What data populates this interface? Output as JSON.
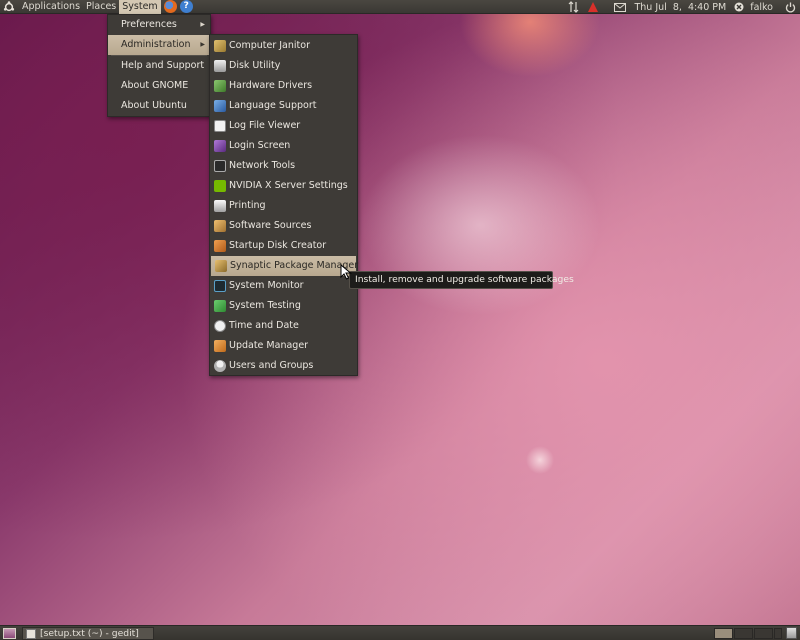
{
  "top_panel": {
    "menus": [
      "Applications",
      "Places",
      "System"
    ],
    "clock": "Thu Jul  8,  4:40 PM",
    "user": "falko"
  },
  "system_menu": {
    "items": [
      "Preferences",
      "Administration",
      "Help and Support",
      "About GNOME",
      "About Ubuntu"
    ],
    "selected": "Administration"
  },
  "admin_menu": {
    "items": [
      {
        "label": "Computer Janitor",
        "icon": "broom-icon",
        "color": "#c9a24a"
      },
      {
        "label": "Disk Utility",
        "icon": "disk-icon",
        "color": "#c8c8c8"
      },
      {
        "label": "Hardware Drivers",
        "icon": "chip-icon",
        "color": "#6aa04a"
      },
      {
        "label": "Language Support",
        "icon": "language-icon",
        "color": "#4a86c8"
      },
      {
        "label": "Log File Viewer",
        "icon": "log-viewer-icon",
        "color": "#e8e8e8"
      },
      {
        "label": "Login Screen",
        "icon": "login-screen-icon",
        "color": "#8a5ab0"
      },
      {
        "label": "Network Tools",
        "icon": "network-tools-icon",
        "color": "#9a9a9a"
      },
      {
        "label": "NVIDIA X Server Settings",
        "icon": "nvidia-icon",
        "color": "#76b900"
      },
      {
        "label": "Printing",
        "icon": "printer-icon",
        "color": "#d8d8d8"
      },
      {
        "label": "Software Sources",
        "icon": "software-sources-icon",
        "color": "#d9a54a"
      },
      {
        "label": "Startup Disk Creator",
        "icon": "startup-disk-icon",
        "color": "#e08a3a"
      },
      {
        "label": "Synaptic Package Manager",
        "icon": "package-icon",
        "color": "#c8a050"
      },
      {
        "label": "System Monitor",
        "icon": "system-monitor-icon",
        "color": "#5aa0c8"
      },
      {
        "label": "System Testing",
        "icon": "checkbox-icon",
        "color": "#4caf50"
      },
      {
        "label": "Time and Date",
        "icon": "clock-icon",
        "color": "#e0e0e0"
      },
      {
        "label": "Update Manager",
        "icon": "update-icon",
        "color": "#e8963a"
      },
      {
        "label": "Users and Groups",
        "icon": "users-icon",
        "color": "#d8d8d8"
      }
    ],
    "selected": "Synaptic Package Manager"
  },
  "tooltip": "Install, remove and upgrade software packages",
  "bottom_panel": {
    "task": "[setup.txt (~) - gedit]"
  },
  "colors": {
    "panel": "#3c3a36",
    "menu_bg": "#3e3b37",
    "selection": "#c6b8a0",
    "accent": "#e8632a"
  }
}
